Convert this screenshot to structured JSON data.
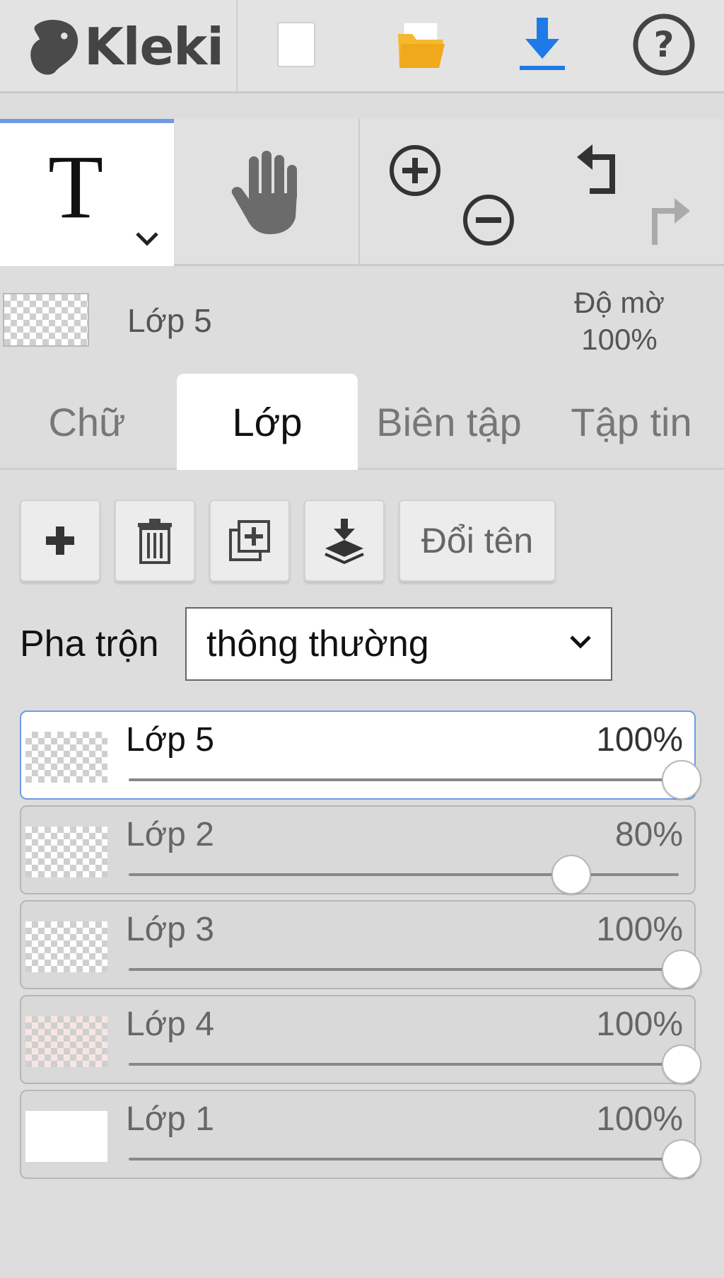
{
  "app": {
    "name": "Kleki"
  },
  "topbar": {
    "icons": [
      "new-file-icon",
      "open-folder-icon",
      "download-icon",
      "help-icon"
    ]
  },
  "tools": {
    "text_tool_glyph": "T",
    "active": "text"
  },
  "layer_info": {
    "name": "Lớp 5",
    "opacity_label": "Độ mờ",
    "opacity_value": "100%"
  },
  "tabs": [
    {
      "label": "Chữ",
      "active": false
    },
    {
      "label": "Lớp",
      "active": true
    },
    {
      "label": "Biên tập",
      "active": false
    },
    {
      "label": "Tập tin",
      "active": false
    }
  ],
  "layer_toolbar": {
    "rename_label": "Đổi tên",
    "icons": [
      "add-layer-icon",
      "trash-icon",
      "duplicate-layer-icon",
      "merge-down-icon"
    ]
  },
  "blend": {
    "label": "Pha trộn",
    "value": "thông thường"
  },
  "layers": [
    {
      "name": "Lớp 5",
      "opacity": "100%",
      "opacity_value": 1.0,
      "selected": true
    },
    {
      "name": "Lớp 2",
      "opacity": "80%",
      "opacity_value": 0.8,
      "selected": false
    },
    {
      "name": "Lớp 3",
      "opacity": "100%",
      "opacity_value": 1.0,
      "selected": false
    },
    {
      "name": "Lớp 4",
      "opacity": "100%",
      "opacity_value": 1.0,
      "selected": false
    },
    {
      "name": "Lớp 1",
      "opacity": "100%",
      "opacity_value": 1.0,
      "selected": false
    }
  ],
  "colors": {
    "accent": "#6f9ae6",
    "download": "#1e7ae6",
    "folder": "#f5b82e"
  }
}
